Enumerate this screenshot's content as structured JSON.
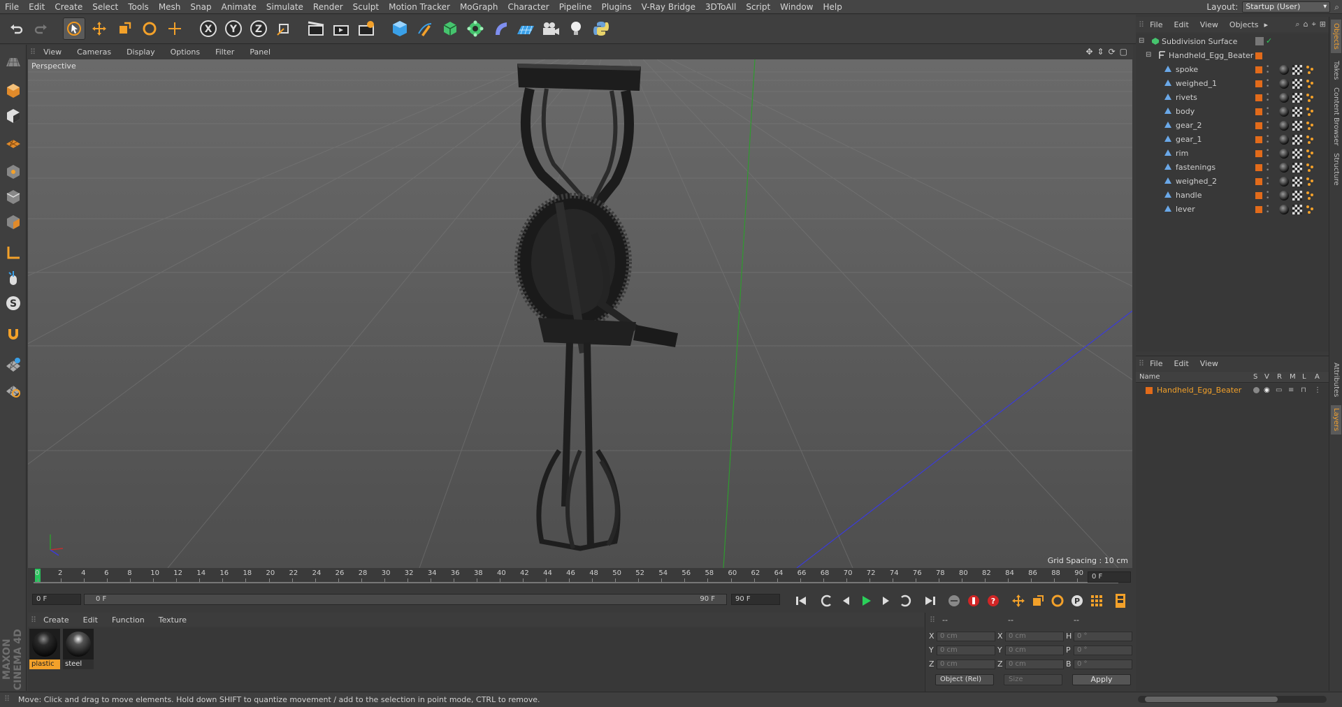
{
  "menu": [
    "File",
    "Edit",
    "Create",
    "Select",
    "Tools",
    "Mesh",
    "Snap",
    "Animate",
    "Simulate",
    "Render",
    "Sculpt",
    "Motion Tracker",
    "MoGraph",
    "Character",
    "Pipeline",
    "Plugins",
    "V-Ray Bridge",
    "3DToAll",
    "Script",
    "Window",
    "Help"
  ],
  "layout": {
    "label": "Layout:",
    "value": "Startup (User)"
  },
  "toolbar": {
    "axis_x": "X",
    "axis_y": "Y",
    "axis_z": "Z"
  },
  "viewport": {
    "menu": [
      "View",
      "Cameras",
      "Display",
      "Options",
      "Filter",
      "Panel"
    ],
    "camera_label": "Perspective",
    "grid_spacing": "Grid Spacing : 10 cm"
  },
  "timeline": {
    "ticks": [
      "0",
      "2",
      "4",
      "6",
      "8",
      "10",
      "12",
      "14",
      "16",
      "18",
      "20",
      "22",
      "24",
      "26",
      "28",
      "30",
      "32",
      "34",
      "36",
      "38",
      "40",
      "42",
      "44",
      "46",
      "48",
      "50",
      "52",
      "54",
      "56",
      "58",
      "60",
      "62",
      "64",
      "66",
      "68",
      "70",
      "72",
      "74",
      "76",
      "78",
      "80",
      "82",
      "84",
      "86",
      "88",
      "90"
    ],
    "current_frame": "0 F",
    "start_field": "0 F",
    "range_start": "0 F",
    "range_end": "90 F",
    "end_field": "90 F"
  },
  "materials": {
    "menu": [
      "Create",
      "Edit",
      "Function",
      "Texture"
    ],
    "items": [
      {
        "name": "plastic",
        "active": true
      },
      {
        "name": "steel",
        "active": false
      }
    ]
  },
  "coords": {
    "header": [
      "--",
      "--",
      "--"
    ],
    "rows": [
      {
        "l1": "X",
        "v1": "0 cm",
        "l2": "X",
        "v2": "0 cm",
        "l3": "H",
        "v3": "0 °"
      },
      {
        "l1": "Y",
        "v1": "0 cm",
        "l2": "Y",
        "v2": "0 cm",
        "l3": "P",
        "v3": "0 °"
      },
      {
        "l1": "Z",
        "v1": "0 cm",
        "l2": "Z",
        "v2": "0 cm",
        "l3": "B",
        "v3": "0 °"
      }
    ],
    "mode": "Object (Rel)",
    "size_mode": "Size",
    "apply": "Apply"
  },
  "objects": {
    "menu": [
      "File",
      "Edit",
      "View",
      "Objects"
    ],
    "root": "Subdivision Surface",
    "group": "Handheld_Egg_Beater",
    "children": [
      "spoke",
      "weighed_1",
      "rivets",
      "body",
      "gear_2",
      "gear_1",
      "rim",
      "fastenings",
      "weighed_2",
      "handle",
      "lever"
    ]
  },
  "right_tabs": [
    "Objects",
    "Takes",
    "Content Browser",
    "Structure",
    "Attributes",
    "Layers"
  ],
  "layers": {
    "menu": [
      "File",
      "Edit",
      "View"
    ],
    "cols": {
      "name": "Name",
      "s": "S",
      "v": "V",
      "r": "R",
      "m": "M",
      "l": "L",
      "a": "A"
    },
    "items": [
      "Handheld_Egg_Beater"
    ]
  },
  "status": "Move: Click and drag to move elements. Hold down SHIFT to quantize movement / add to the selection in point mode, CTRL to remove.",
  "brand": "MAXON CINEMA 4D",
  "colors": {
    "accent": "#f3a12a",
    "layer_name": "#f3a12a",
    "tag": "#e26b1a"
  }
}
